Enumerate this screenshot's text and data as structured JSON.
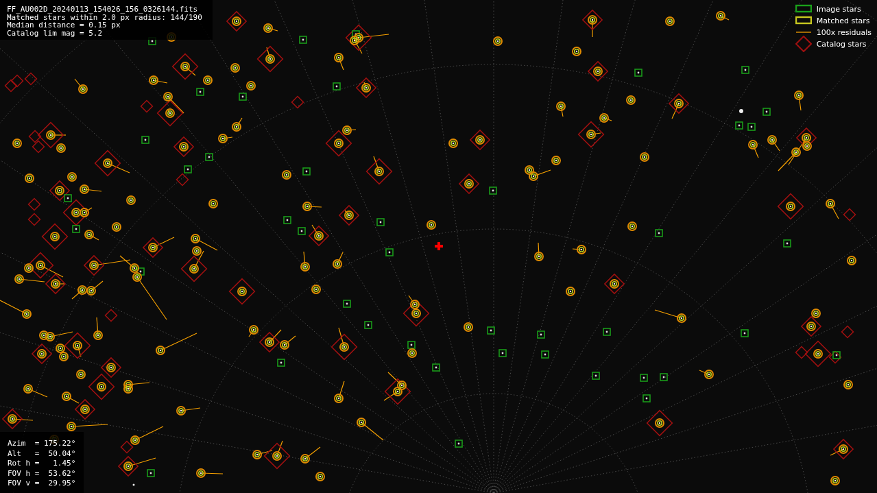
{
  "info_top": [
    "FF_AU002D_20240113_154026_156_0326144.fits",
    "Matched stars within 2.0 px radius: 144/190",
    "Median distance = 0.15 px",
    "Catalog lim mag = 5.2"
  ],
  "legend": [
    {
      "kind": "image",
      "label": "Image stars"
    },
    {
      "kind": "matched",
      "label": "Matched stars"
    },
    {
      "kind": "residual",
      "label": "100x residuals"
    },
    {
      "kind": "catalog",
      "label": "Catalog stars"
    }
  ],
  "pointing": [
    "Azim  = 175.22°",
    "Alt   =  50.04°",
    "Rot h =   1.45°",
    "FOV h =  53.62°",
    "FOV v =  29.95°"
  ]
}
